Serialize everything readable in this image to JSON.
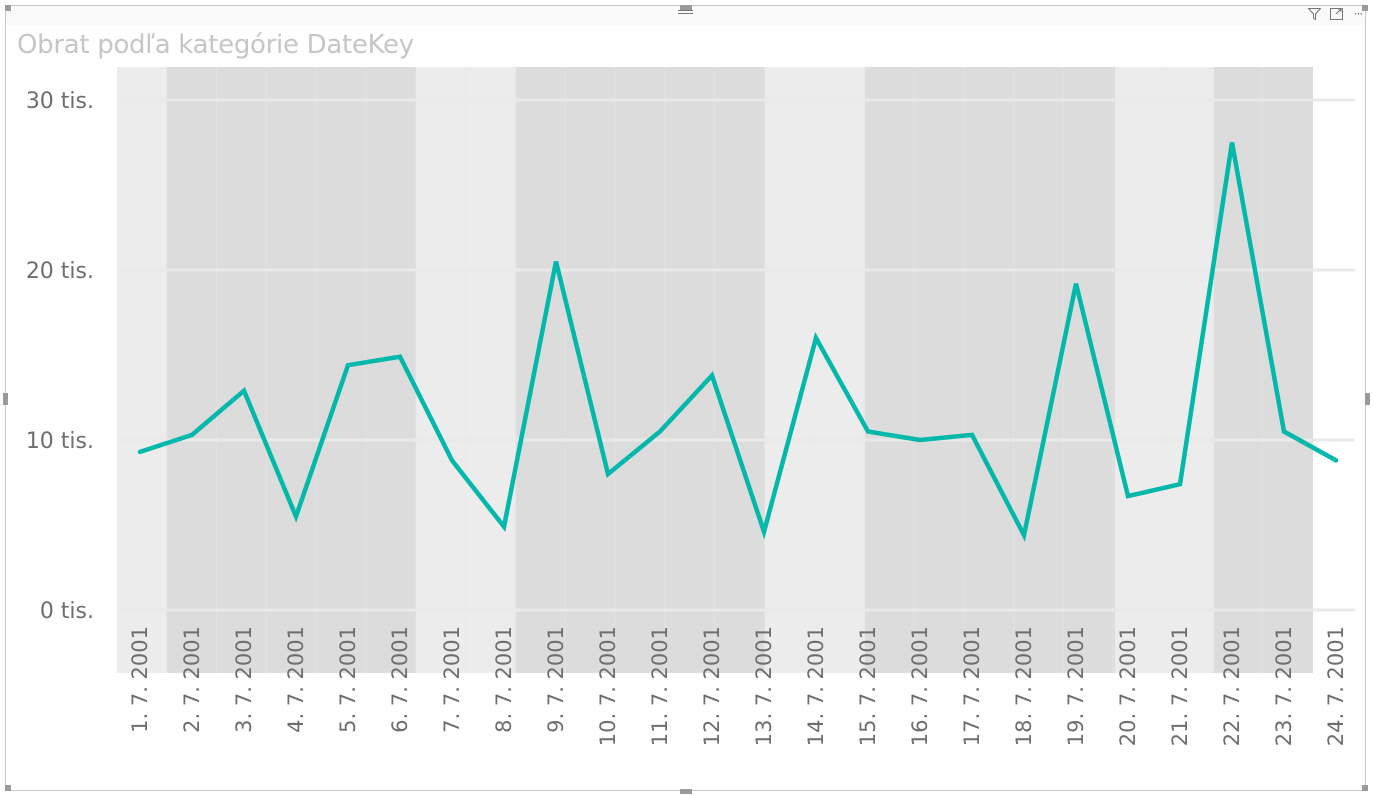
{
  "visual": {
    "toolbar": {
      "filter_icon": "filter-icon",
      "focus_icon": "focus-mode-icon",
      "more_icon": "more-options-icon",
      "more_label": "···"
    }
  },
  "chart_data": {
    "type": "line",
    "title": "Obrat podľa kategórie DateKey",
    "xlabel": "",
    "ylabel": "",
    "categories": [
      "1. 7. 2001",
      "2. 7. 2001",
      "3. 7. 2001",
      "4. 7. 2001",
      "5. 7. 2001",
      "6. 7. 2001",
      "7. 7. 2001",
      "8. 7. 2001",
      "9. 7. 2001",
      "10. 7. 2001",
      "11. 7. 2001",
      "12. 7. 2001",
      "13. 7. 2001",
      "14. 7. 2001",
      "15. 7. 2001",
      "16. 7. 2001",
      "17. 7. 2001",
      "18. 7. 2001",
      "19. 7. 2001",
      "20. 7. 2001",
      "21. 7. 2001",
      "22. 7. 2001",
      "23. 7. 2001",
      "24. 7. 2001"
    ],
    "series": [
      {
        "name": "Obrat",
        "color": "#01B8AA",
        "values": [
          9300,
          10300,
          12900,
          5500,
          14400,
          14900,
          8800,
          4900,
          20500,
          8000,
          10500,
          13800,
          4600,
          16000,
          10500,
          10000,
          10300,
          4400,
          19200,
          6700,
          7400,
          27500,
          10500,
          8800
        ]
      }
    ],
    "ylim": [
      0,
      32000
    ],
    "yticks": [
      {
        "value": 0,
        "label": "0 tis."
      },
      {
        "value": 10000,
        "label": "10 tis."
      },
      {
        "value": 20000,
        "label": "20 tis."
      },
      {
        "value": 30000,
        "label": "30 tis."
      }
    ],
    "grid": true,
    "legend": "none",
    "colors": {
      "line": "#01B8AA",
      "band_light": "#ececec",
      "band_dark": "#dcdcdc",
      "gridline": "#e9e9e9"
    }
  }
}
